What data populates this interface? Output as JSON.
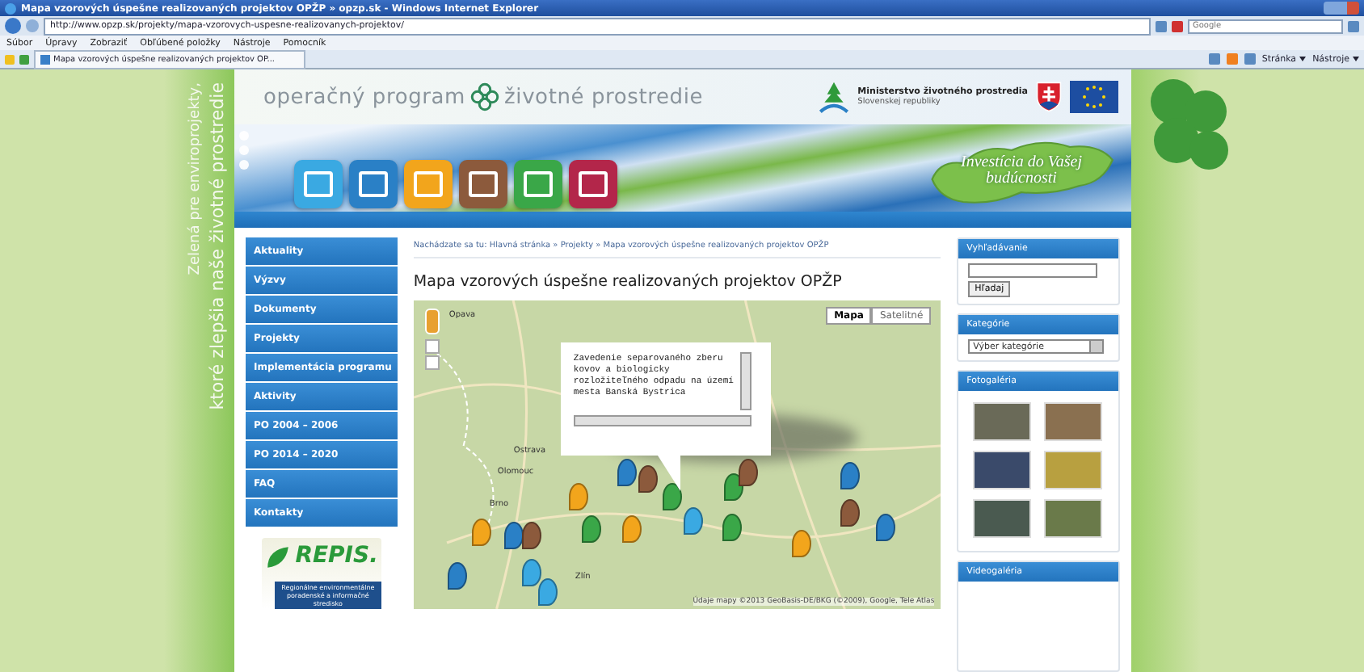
{
  "browser": {
    "title": "Mapa vzorových úspešne realizovaných projektov OPŽP » opzp.sk - Windows Internet Explorer",
    "address": "http://www.opzp.sk/projekty/mapa-vzorovych-uspesne-realizovanych-projektov/",
    "search_placeholder": "Google",
    "menu": [
      "Súbor",
      "Úpravy",
      "Zobraziť",
      "Obľúbené položky",
      "Nástroje",
      "Pomocník"
    ],
    "tab": "Mapa vzorových úspešne realizovaných projektov OP...",
    "toolbar": [
      "Stránka",
      "Nástroje"
    ]
  },
  "side_slogan": [
    "Zelená pre enviroprojekty,",
    "ktoré zlepšia naše životné prostredie"
  ],
  "header": {
    "logo_left": "operačný program",
    "logo_right": "životné prostredie",
    "ministry": "Ministerstvo životného prostredia",
    "ministry_sub": "Slovenskej republiky",
    "slogan": "Investícia do Vašej budúcnosti",
    "tiles": [
      {
        "color": "#3aa9e2"
      },
      {
        "color": "#2a80c6"
      },
      {
        "color": "#f2a51c"
      },
      {
        "color": "#8c5a3c"
      },
      {
        "color": "#3aa748"
      },
      {
        "color": "#b3264a"
      }
    ]
  },
  "nav": [
    "Aktuality",
    "Výzvy",
    "Dokumenty",
    "Projekty",
    "Implementácia programu",
    "Aktivity",
    "PO 2004 – 2006",
    "PO 2014 – 2020",
    "FAQ",
    "Kontakty"
  ],
  "repis": {
    "title": "REPIS.",
    "subtitle": "Regionálne environmentálne poradenské a informačné stredisko"
  },
  "breadcrumb": "Nachádzate sa tu: Hlavná stránka » Projekty » Mapa vzorových úspešne realizovaných projektov OPŽP",
  "heading": "Mapa vzorových úspešne realizovaných projektov OPŽP",
  "map": {
    "types": [
      {
        "label": "Mapa",
        "selected": true
      },
      {
        "label": "Satelitné",
        "selected": false
      }
    ],
    "labels": [
      "Opava",
      "Ostrava",
      "Olomouc",
      "Brno",
      "Zlín"
    ],
    "popup": "Zavedenie separovaného zberu kovov a biologicky rozložiteľného odpadu na území mesta Banská Bystrica",
    "attribution": "Údaje mapy ©2013 GeoBasis-DE/BKG (©2009), Google, Tele Atlas",
    "markers": [
      {
        "color": "#2a80c6"
      },
      {
        "color": "#8c5a3c"
      },
      {
        "color": "#f2a51c"
      },
      {
        "color": "#3aa748"
      },
      {
        "color": "#3aa748"
      },
      {
        "color": "#8c5a3c"
      },
      {
        "color": "#2a80c6"
      },
      {
        "color": "#f2a51c"
      },
      {
        "color": "#2a80c6"
      },
      {
        "color": "#8c5a3c"
      },
      {
        "color": "#3aa748"
      },
      {
        "color": "#f2a51c"
      },
      {
        "color": "#3aa9e2"
      },
      {
        "color": "#3aa748"
      },
      {
        "color": "#f2a51c"
      },
      {
        "color": "#8c5a3c"
      },
      {
        "color": "#2a80c6"
      },
      {
        "color": "#2a80c6"
      },
      {
        "color": "#3aa9e2"
      },
      {
        "color": "#3aa9e2"
      }
    ]
  },
  "sidebar": {
    "search_title": "Vyhľadávanie",
    "search_button": "Hľadaj",
    "categories_title": "Kategórie",
    "category_select": "Výber kategórie",
    "gallery_title": "Fotogaléria",
    "video_title": "Videogaléria"
  }
}
